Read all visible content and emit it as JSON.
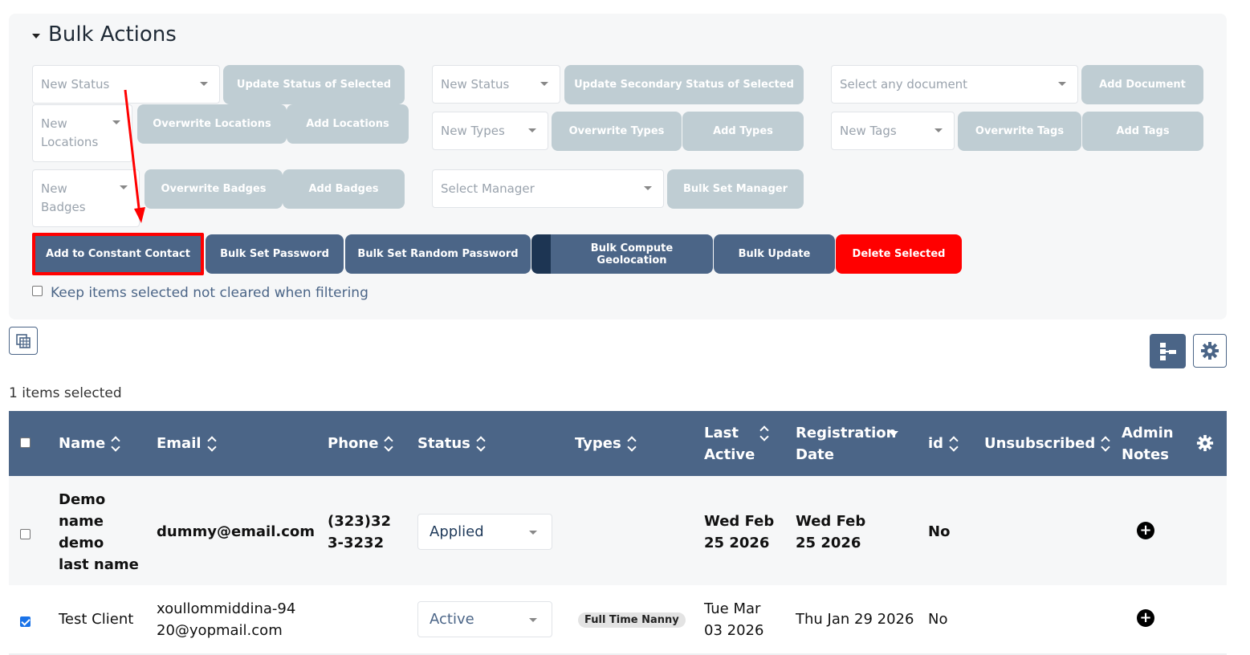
{
  "bulk": {
    "title": "Bulk Actions",
    "new_status_placeholder": "New Status",
    "update_status_btn": "Update Status of Selected",
    "new_locations_placeholder": "New Locations",
    "overwrite_locations_btn": "Overwrite Locations",
    "add_locations_btn": "Add Locations",
    "new_badges_placeholder": "New Badges",
    "overwrite_badges_btn": "Overwrite Badges",
    "add_badges_btn": "Add Badges",
    "new_status2_placeholder": "New Status",
    "update_secondary_btn": "Update Secondary Status of Selected",
    "new_types_placeholder": "New Types",
    "overwrite_types_btn": "Overwrite Types",
    "add_types_btn": "Add Types",
    "select_manager_placeholder": "Select Manager",
    "bulk_set_manager_btn": "Bulk Set Manager",
    "select_document_placeholder": "Select any document",
    "add_document_btn": "Add Document",
    "new_tags_placeholder": "New Tags",
    "overwrite_tags_btn": "Overwrite Tags",
    "add_tags_btn": "Add Tags",
    "add_constant_contact_btn": "Add to Constant Contact",
    "bulk_set_password_btn": "Bulk Set Password",
    "bulk_set_random_password_btn": "Bulk Set Random Password",
    "bulk_compute_geolocation_btn": "Bulk Compute Geolocation",
    "bulk_update_btn": "Bulk Update",
    "delete_selected_btn": "Delete Selected",
    "keep_selected_label": "Keep items selected not cleared when filtering"
  },
  "selection_text": "1 items selected",
  "table": {
    "headers": {
      "name": "Name",
      "email": "Email",
      "phone": "Phone",
      "status": "Status",
      "types": "Types",
      "last_active": "Last Active",
      "registration_date": "Registration Date",
      "id": "id",
      "unsubscribed": "Unsubscribed",
      "admin_notes": "Admin Notes"
    },
    "rows": [
      {
        "checked": false,
        "name": "Demo name demo last name",
        "email": "dummy@email.com",
        "phone": "(323)323-3232",
        "status": "Applied",
        "types": "",
        "last_active": "Wed Feb 25 2026",
        "registration_date": "Wed Feb 25 2026",
        "id": "",
        "unsubscribed": "No"
      },
      {
        "checked": true,
        "name": "Test Client",
        "email": "xoullommiddina-9420@yopmail.com",
        "phone": "",
        "status": "Active",
        "types": "Full Time Nanny",
        "last_active": "Tue Mar 03 2026",
        "registration_date": "Thu Jan 29 2026",
        "id": "",
        "unsubscribed": "No"
      }
    ]
  },
  "colors": {
    "header_bg": "#4b6587",
    "disabled_btn": "#bfcdd3",
    "danger": "#ff0000",
    "highlight": "#ff0000"
  }
}
